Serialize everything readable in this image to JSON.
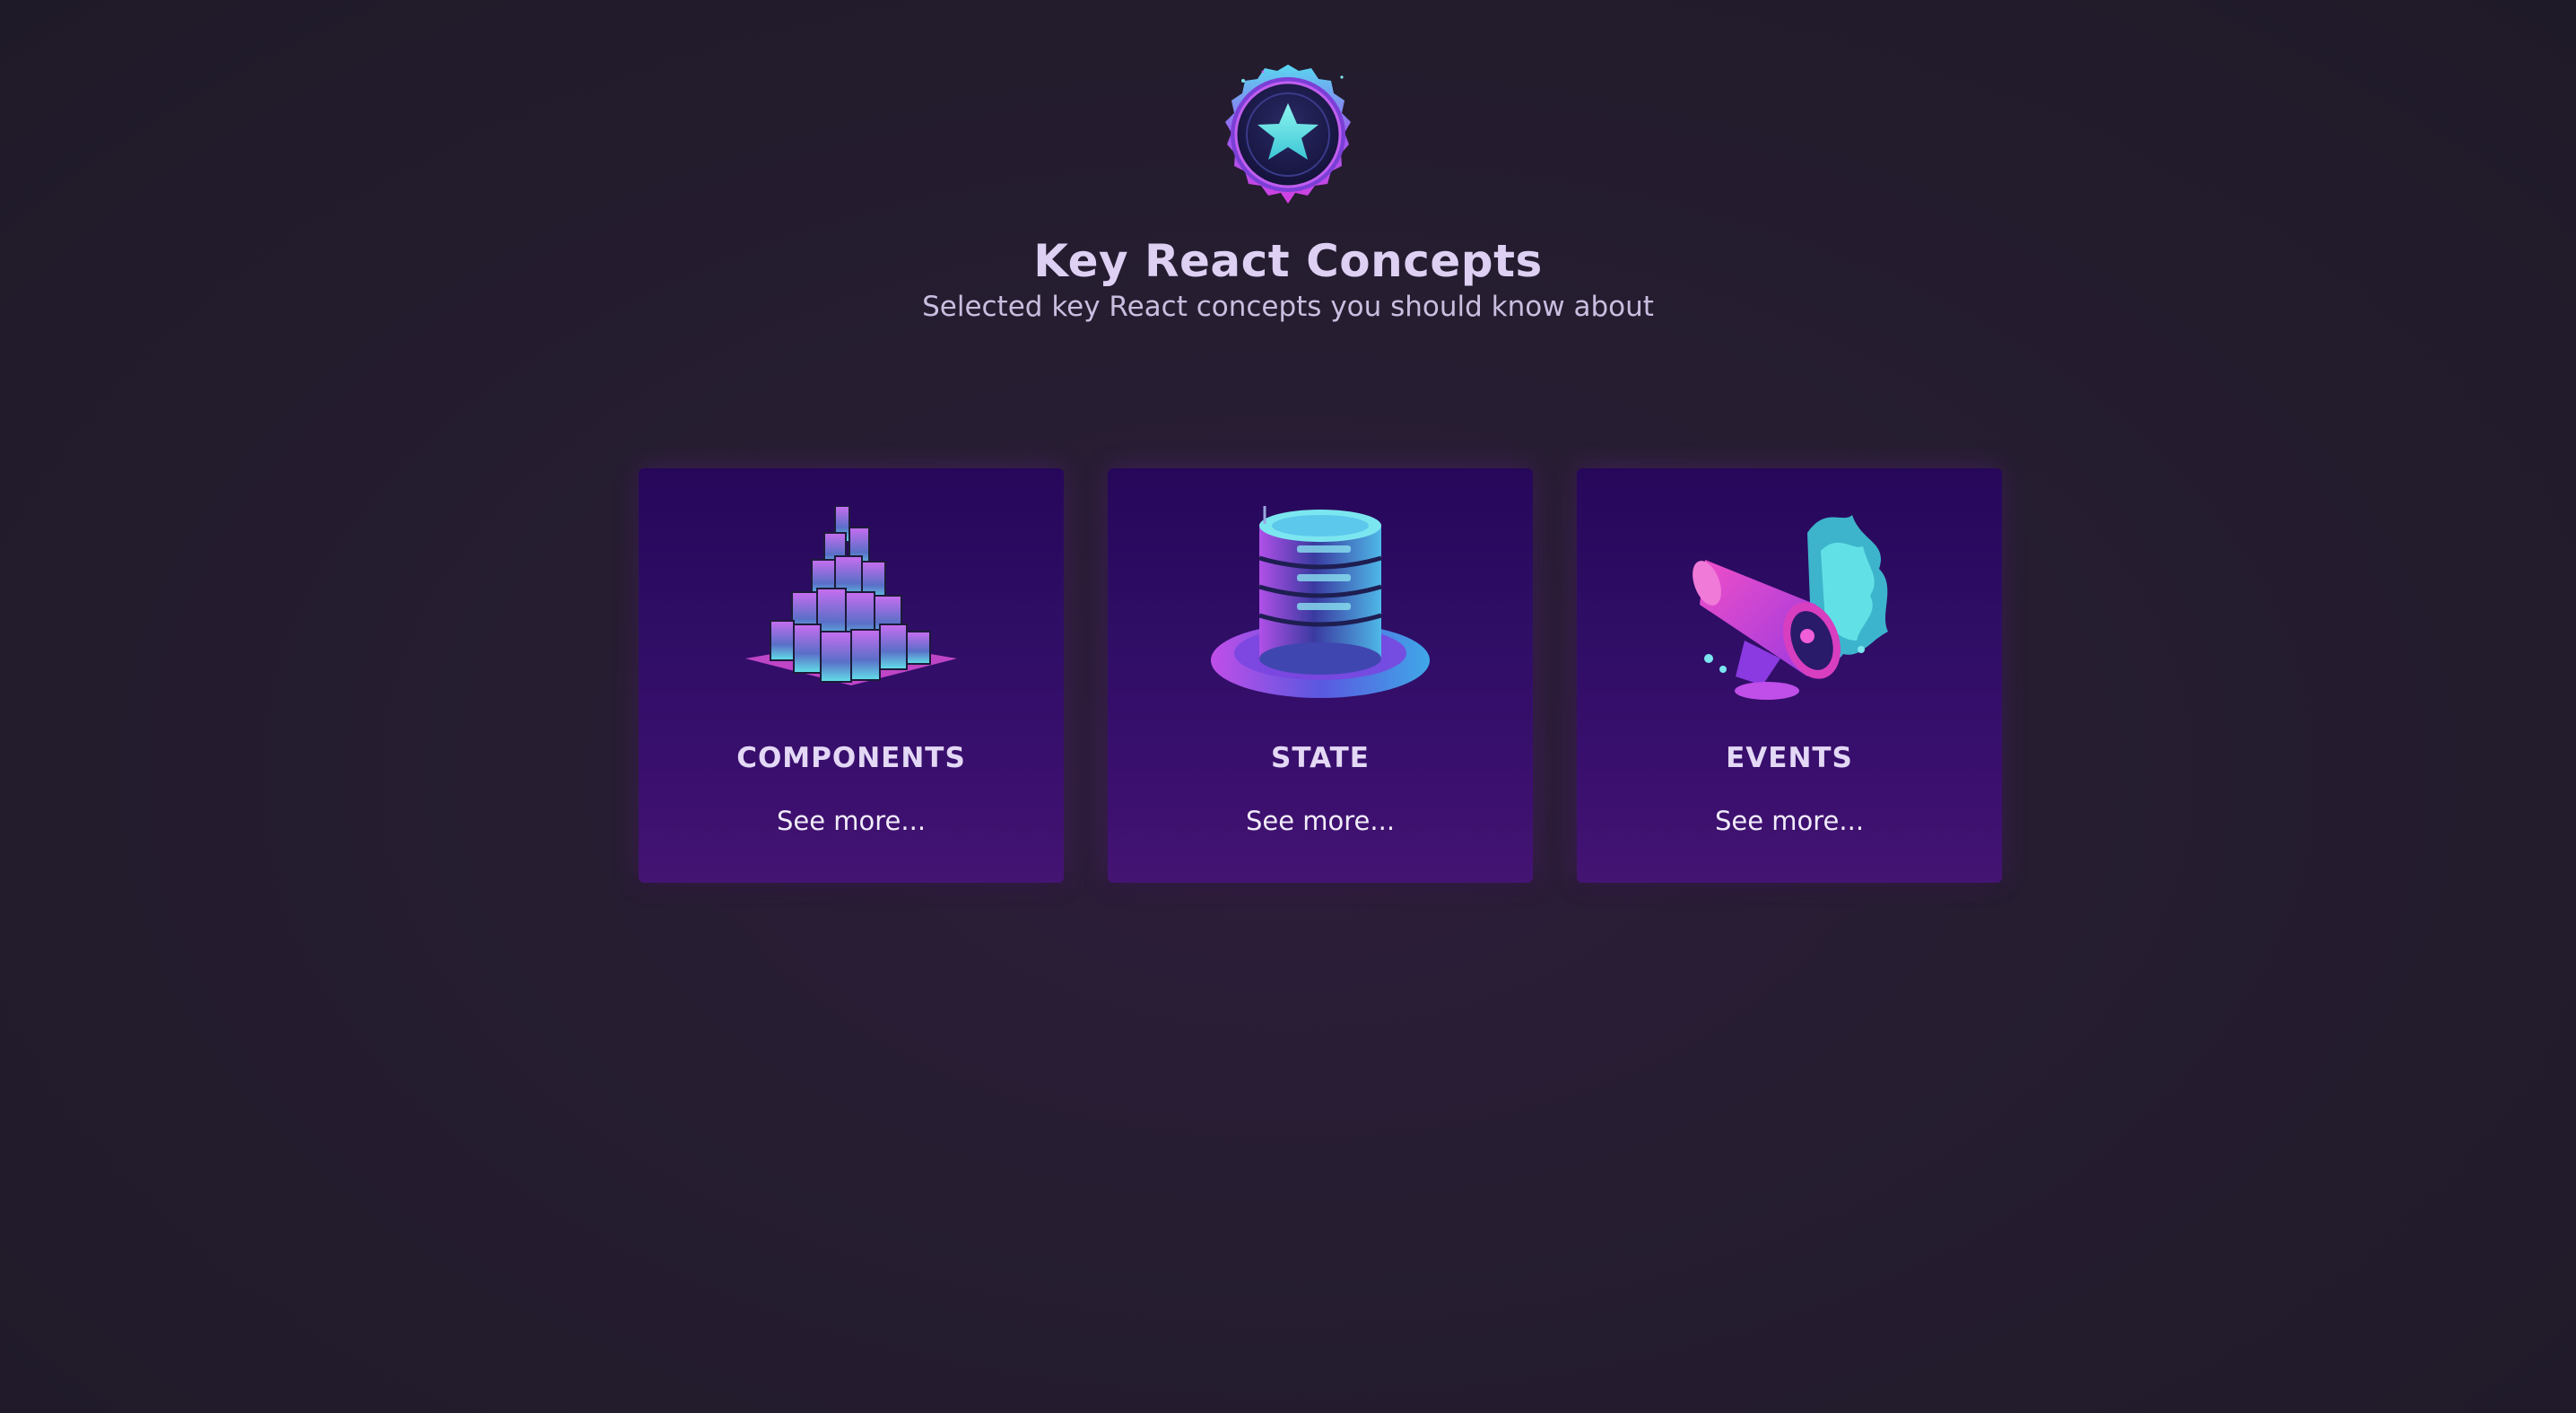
{
  "header": {
    "title": "Key React Concepts",
    "subtitle": "Selected key React concepts you should know about",
    "badge_icon": "star-badge-icon"
  },
  "concepts": [
    {
      "title": "COMPONENTS",
      "link": "See more...",
      "icon": "blocks-icon"
    },
    {
      "title": "STATE",
      "link": "See more...",
      "icon": "database-icon"
    },
    {
      "title": "EVENTS",
      "link": "See more...",
      "icon": "megaphone-icon"
    }
  ],
  "colors": {
    "background": "#231d2f",
    "card_top": "#26075a",
    "card_bottom": "#441473",
    "accent_cyan": "#5fe0e6",
    "accent_magenta": "#c63cf0",
    "title_text": "#ddd0f3"
  }
}
